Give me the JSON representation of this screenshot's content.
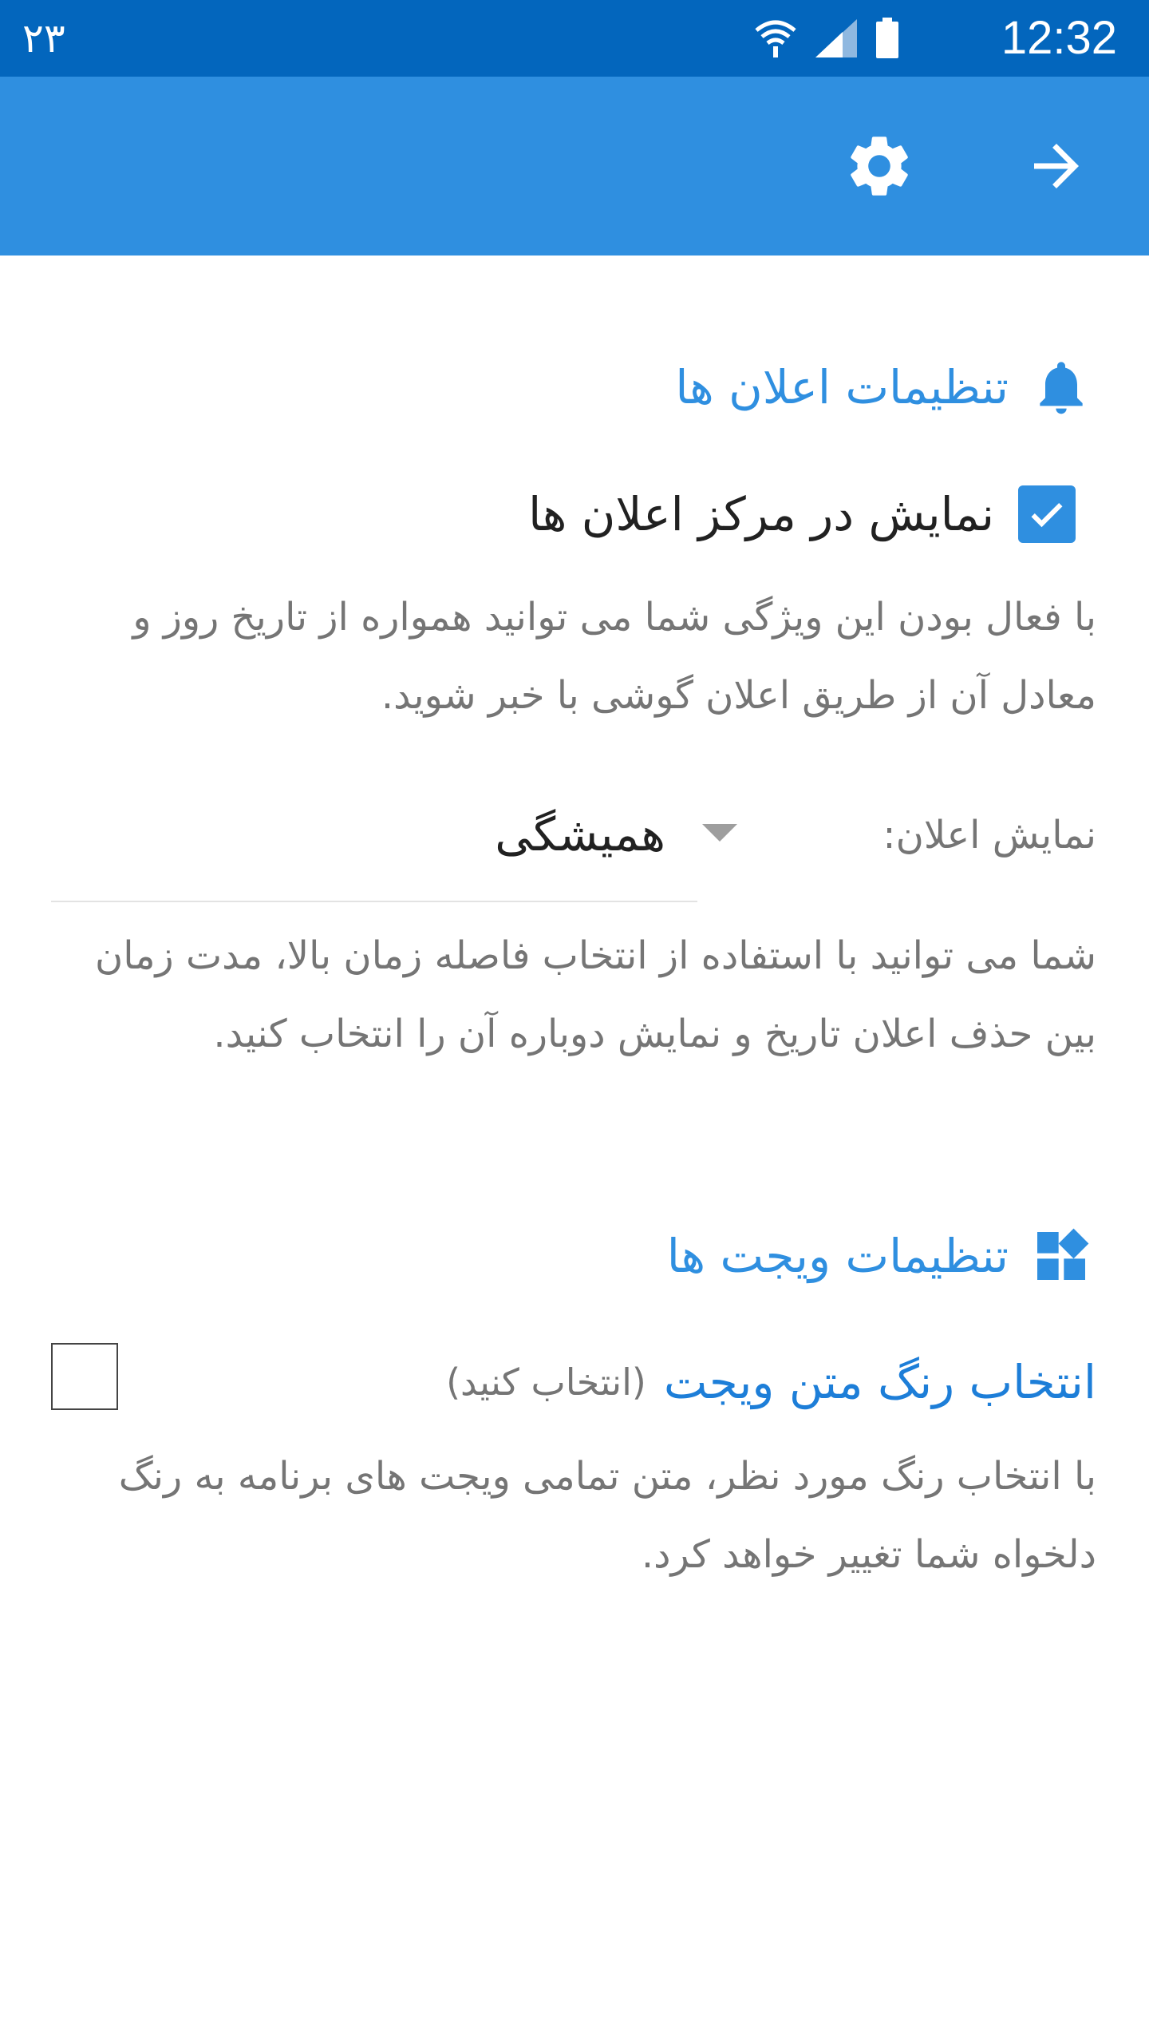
{
  "status_bar": {
    "notification_count": "۲۳",
    "time": "12:32",
    "icons": [
      "wifi-icon",
      "signal-icon",
      "battery-icon"
    ]
  },
  "app_bar": {
    "icons": [
      "gear-icon",
      "arrow-right-icon"
    ],
    "color": "#2f8fe0"
  },
  "notification_section": {
    "title": "تنظیمات اعلان ها",
    "icon": "bell-icon",
    "show_in_center": {
      "label": "نمایش در مرکز اعلان ها",
      "checked": true
    },
    "description": "با فعال بودن این ویژگی شما می توانید همواره از تاریخ روز و معادل آن از طریق اعلان گوشی با خبر شوید.",
    "display_label": "نمایش اعلان:",
    "display_value": "همیشگی",
    "display_description": "شما می توانید با استفاده از انتخاب فاصله زمان بالا، مدت زمان بین حذف اعلان تاریخ و نمایش دوباره آن را انتخاب کنید."
  },
  "widget_section": {
    "title": "تنظیمات ویجت ها",
    "icon": "widgets-icon",
    "text_color_title": "انتخاب رنگ متن ویجت",
    "text_color_hint": "(انتخاب کنید)",
    "description": "با انتخاب رنگ مورد نظر، متن تمامی ویجت های برنامه به رنگ دلخواه شما تغییر خواهد کرد."
  },
  "colors": {
    "status_bar": "#0366bd",
    "accent": "#2f8fe0"
  }
}
